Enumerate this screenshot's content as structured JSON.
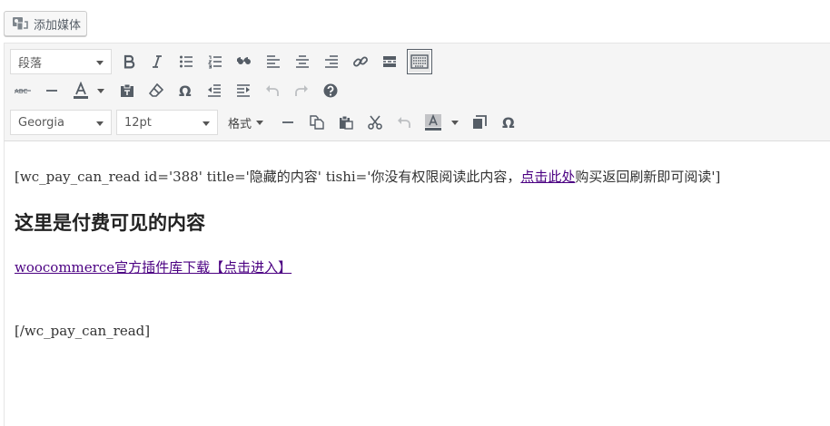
{
  "media": {
    "add_media_label": "添加媒体"
  },
  "toolbar": {
    "paragraph_select": "段落",
    "font_family_select": "Georgia",
    "font_size_select": "12pt",
    "format_menu": "格式"
  },
  "content": {
    "shortcode_open_prefix": "[wc_pay_can_read id='388' title='隐藏的内容'  tishi='你没有权限阅读此内容，",
    "shortcode_link_text": "点击此处",
    "shortcode_open_suffix": "购买返回刷新即可阅读']",
    "heading": "这里是付费可见的内容",
    "download_link_text": "woocommerce官方插件库下载【点击进入】",
    "shortcode_close": "[/wc_pay_can_read]"
  },
  "colors": {
    "link": "#4b0082",
    "toolbar_bg": "#f5f5f5",
    "icon": "#555d66"
  }
}
